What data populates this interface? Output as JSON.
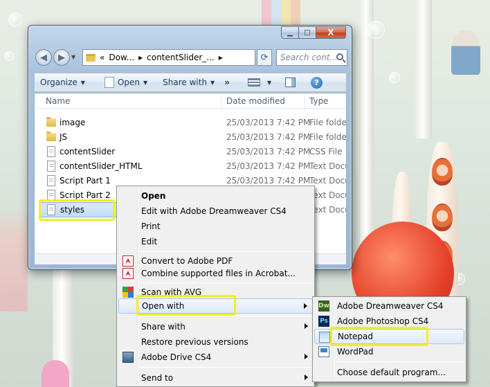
{
  "window": {
    "caption": {
      "minimize": "▁",
      "maximize": "□",
      "close": "X"
    },
    "address": {
      "chev": "«",
      "seg1": "Dow...",
      "sep1": "▸",
      "seg2": "contentSlider_...",
      "sep2": "▸"
    },
    "search_placeholder": "Search cont...",
    "toolbar": {
      "organize": "Organize",
      "open": "Open",
      "share_with": "Share with",
      "more": "»"
    },
    "columns": {
      "name": "Name",
      "date": "Date modified",
      "type": "Type"
    },
    "files": [
      {
        "name": "image",
        "date": "25/03/2013 7:42 PM",
        "type": "File folder",
        "kind": "folder"
      },
      {
        "name": "JS",
        "date": "25/03/2013 7:42 PM",
        "type": "File folder",
        "kind": "folder"
      },
      {
        "name": "contentSlider",
        "date": "25/03/2013 7:42 PM",
        "type": "CSS File",
        "kind": "file"
      },
      {
        "name": "contentSlider_HTML",
        "date": "25/03/2013 7:42 PM",
        "type": "Text Docum",
        "kind": "file"
      },
      {
        "name": "Script Part 1",
        "date": "25/03/2013 7:42 PM",
        "type": "Text Docum",
        "kind": "file"
      },
      {
        "name": "Script Part 2",
        "date": "",
        "type": "Text Docum",
        "kind": "file"
      },
      {
        "name": "styles",
        "date": "",
        "type": "Text Docum",
        "kind": "file",
        "selected": true
      }
    ]
  },
  "context_menu": {
    "items": [
      {
        "label": "Open",
        "bold": true
      },
      {
        "label": "Edit with Adobe Dreamweaver CS4"
      },
      {
        "label": "Print"
      },
      {
        "label": "Edit"
      },
      {
        "label": "Convert to Adobe PDF",
        "icon": "pdf-icon"
      },
      {
        "label": "Combine supported files in Acrobat...",
        "icon": "acrobat-icon"
      },
      {
        "label": "Scan with AVG",
        "icon": "avg-icon"
      },
      {
        "label": "Open with",
        "submenu": true,
        "highlighted": true
      },
      {
        "label": "Share with",
        "submenu": true
      },
      {
        "label": "Restore previous versions"
      },
      {
        "label": "Adobe Drive CS4",
        "submenu": true,
        "icon": "adobe-drive-icon"
      },
      {
        "label": "Send to",
        "submenu": true
      }
    ]
  },
  "open_with_menu": {
    "items": [
      {
        "label": "Adobe Dreamweaver CS4",
        "icon": "dreamweaver-icon",
        "badge": "Dw"
      },
      {
        "label": "Adobe Photoshop CS4",
        "icon": "photoshop-icon",
        "badge": "Ps"
      },
      {
        "label": "Notepad",
        "icon": "notepad-icon",
        "highlighted": true
      },
      {
        "label": "WordPad",
        "icon": "wordpad-icon"
      },
      {
        "label": "Choose default program..."
      }
    ]
  },
  "colors": {
    "highlight_box": "#f1ef20",
    "menu_bg": "#f0f0f0",
    "window_frame": "#a9c2dc"
  }
}
